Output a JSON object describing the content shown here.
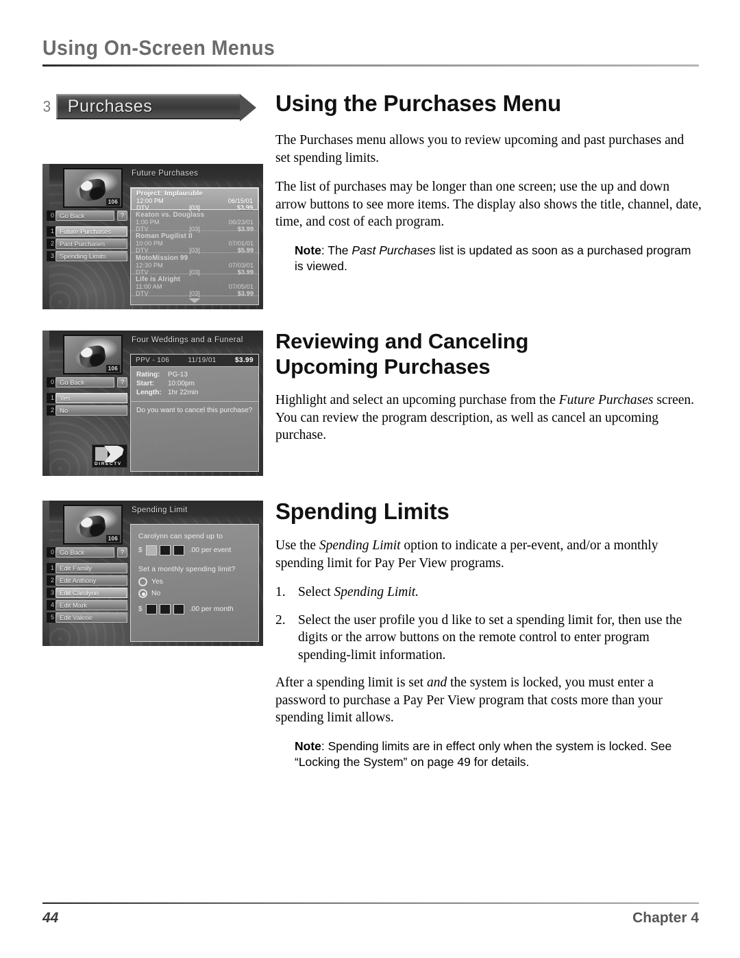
{
  "running_head": "Using On-Screen Menus",
  "menu_tag": {
    "number": "3",
    "label": "Purchases"
  },
  "sections": {
    "purchases": {
      "title": "Using the Purchases Menu",
      "p1": "The Purchases menu allows you to review upcoming and past purchases and set spending limits.",
      "p2": "The list of purchases may be longer than one screen; use the up and down arrow buttons to see more items. The display also shows the title, channel, date, time, and cost of each program.",
      "note_label": "Note",
      "note_a": ": The ",
      "note_em": "Past Purchases",
      "note_b": " list is updated as soon as a purchased program is viewed."
    },
    "reviewing": {
      "title_line1": "Reviewing and Canceling",
      "title_line2": "Upcoming Purchases",
      "p1_a": "Highlight and select an upcoming purchase from the ",
      "p1_em": "Future Purchases",
      "p1_b": " screen. You can review the program description, as well as cancel an upcoming purchase."
    },
    "spending": {
      "title": "Spending Limits",
      "p1_a": "Use the ",
      "p1_em": "Spending Limit",
      "p1_b": " option to indicate a per-event, and/or a monthly spending limit for Pay Per View programs.",
      "step1_num": "1.",
      "step1_a": "Select ",
      "step1_em": "Spending Limit.",
      "step2_num": "2.",
      "step2": "Select the user profile you d like to set a spending limit for, then use the digits or the arrow buttons on the remote control to enter program spending-limit information.",
      "p2": "After a spending limit is set and the system is locked, you must enter a password to purchase a Pay Per View program that costs more than your spending limit allows.",
      "p2_a": "After a spending limit is set ",
      "p2_em": "and",
      "p2_b": " the system is locked, you must enter a password to purchase a Pay Per View program that costs more than your spending limit allows.",
      "note_label": "Note",
      "note_text": ": Spending limits are in effect only when the system is locked. See “Locking the System” on page 49 for details."
    }
  },
  "tv1": {
    "panel_title": "Future Purchases",
    "thumb_channel": "106",
    "menu": [
      {
        "key": "0",
        "label": "Go Back",
        "help": "?",
        "selected": false,
        "arrow": false
      },
      {
        "key": "1",
        "label": "Future Purchases",
        "selected": true,
        "arrow": true
      },
      {
        "key": "2",
        "label": "Past Purchases",
        "selected": false,
        "arrow": true
      },
      {
        "key": "3",
        "label": "Spending Limits",
        "selected": false,
        "arrow": true
      }
    ],
    "programs": [
      {
        "title": "Project: Implausible",
        "time": "12:00 PM",
        "date": "06/15/01",
        "source": "DTV",
        "channel": "[03]",
        "price": "$3.99",
        "highlighted": true
      },
      {
        "title": "Keaton vs. Douglass",
        "time": "1:00 PM",
        "date": "06/23/01",
        "source": "DTV",
        "channel": "[03]",
        "price": "$3.99",
        "highlighted": false
      },
      {
        "title": "Roman Pugilist II",
        "time": "10:00 PM",
        "date": "07/01/01",
        "source": "DTV",
        "channel": "[03]",
        "price": "$5.99",
        "highlighted": false
      },
      {
        "title": "MotoMission 99",
        "time": "12:30 PM",
        "date": "07/03/01",
        "source": "DTV",
        "channel": "[03]",
        "price": "$3.99",
        "highlighted": false
      },
      {
        "title": "Life is Alright",
        "time": "11:00 AM",
        "date": "07/05/01",
        "source": "DTV",
        "channel": "[03]",
        "price": "$3.99",
        "highlighted": false
      }
    ]
  },
  "tv2": {
    "panel_title": "Four Weddings and a Funeral",
    "thumb_channel": "106",
    "menu": [
      {
        "key": "0",
        "label": "Go Back",
        "help": "?",
        "selected": false,
        "arrow": false
      },
      {
        "key": "1",
        "label": "Yes",
        "selected": true,
        "arrow": false
      },
      {
        "key": "2",
        "label": "No",
        "selected": false,
        "arrow": false
      }
    ],
    "header": {
      "source": "PPV - 106",
      "date": "11/19/01",
      "price": "$3.99"
    },
    "info": [
      {
        "key": "Rating:",
        "value": "PG-13"
      },
      {
        "key": "Start:",
        "value": "10:00pm"
      },
      {
        "key": "Length:",
        "value": "1hr 22min"
      }
    ],
    "question": "Do you want to cancel this purchase?",
    "logo_text": "DIRECTV"
  },
  "tv3": {
    "panel_title": "Spending Limit",
    "thumb_channel": "106",
    "menu": [
      {
        "key": "0",
        "label": "Go Back",
        "help": "?",
        "selected": false,
        "arrow": false
      },
      {
        "key": "1",
        "label": "Edit Family",
        "selected": false,
        "arrow": true
      },
      {
        "key": "2",
        "label": "Edit Anthony",
        "selected": false,
        "arrow": true
      },
      {
        "key": "3",
        "label": "Edit Carolynn",
        "selected": true,
        "arrow": true
      },
      {
        "key": "4",
        "label": "Edit Mark",
        "selected": false,
        "arrow": true
      },
      {
        "key": "5",
        "label": "Edit Valerie",
        "selected": false,
        "arrow": true
      }
    ],
    "line1": "Carolynn can spend up to",
    "event_dollar": "$",
    "event_suffix": ".00 per event",
    "line2": "Set a monthly spending limit?",
    "radio_yes": "Yes",
    "radio_no": "No",
    "radio_selected": "No",
    "month_dollar": "$",
    "month_suffix": ".00 per month"
  },
  "footer": {
    "page_number": "44",
    "chapter": "Chapter 4"
  }
}
